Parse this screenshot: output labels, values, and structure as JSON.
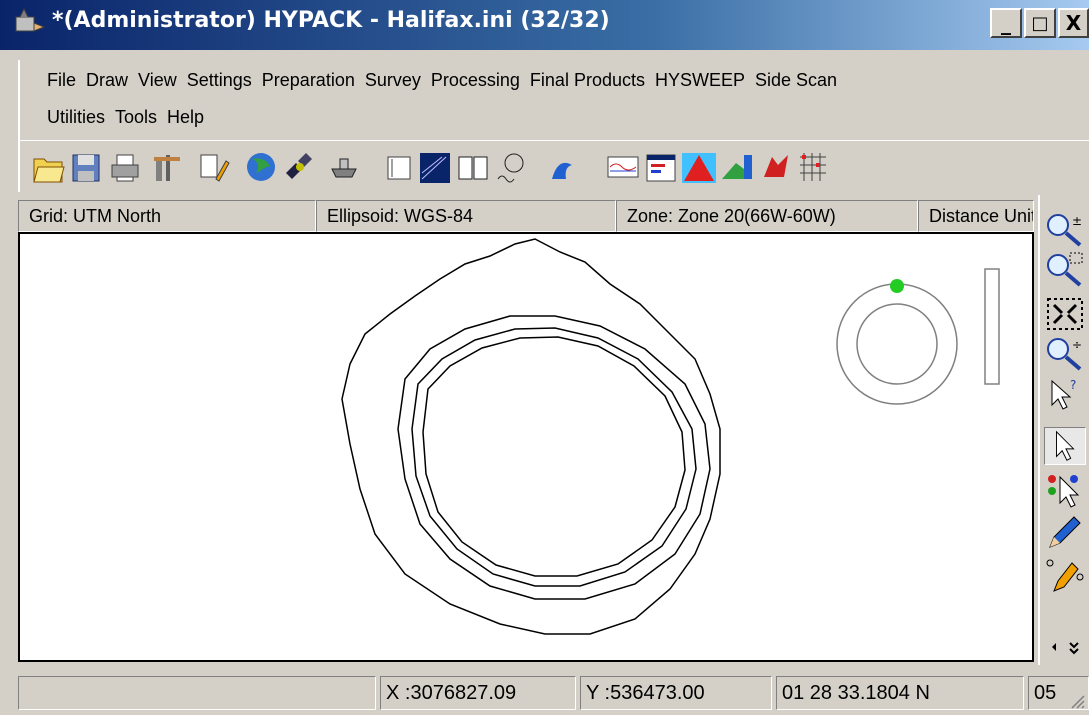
{
  "window": {
    "title": "*(Administrator) HYPACK - Halifax.ini (32/32)",
    "minimize_label": "_",
    "maximize_label": "□",
    "close_label": "X"
  },
  "menu": {
    "row1": [
      "File",
      "Draw",
      "View",
      "Settings",
      "Preparation",
      "Survey",
      "Processing",
      "Final Products",
      "HYSWEEP",
      "Side Scan"
    ],
    "row2": [
      "Utilities",
      "Tools",
      "Help"
    ]
  },
  "toolbar": {
    "icons": [
      "open-folder-icon",
      "save-disk-icon",
      "print-icon",
      "hardware-icon",
      "edit-draw-icon",
      "globe-icon",
      "satellite-icon",
      "boat-icon",
      "display-icon",
      "sounding-icon",
      "book-icon",
      "tide-icon",
      "wave-icon",
      "profile-icon",
      "chart-icon",
      "tin-icon",
      "terrain-icon",
      "dragon-icon",
      "grid-icon"
    ]
  },
  "infobar": {
    "grid": "Grid: UTM North",
    "ellipsoid": "Ellipsoid: WGS-84",
    "zone": "Zone: Zone 20(66W-60W)",
    "distance": "Distance Units:"
  },
  "status": {
    "blank": "",
    "x": "X :3076827.09",
    "y": "Y :536473.00",
    "lat": "01 28 33.1804 N",
    "extra": "05"
  },
  "right_tools": [
    "zoom-in-out-icon",
    "zoom-window-icon",
    "zoom-extents-icon",
    "zoom-point-icon",
    "query-pointer-icon",
    "select-pointer-icon",
    "multi-select-icon",
    "pen-draw-icon",
    "pen-edit-icon"
  ],
  "colors": {
    "title_start": "#0a246a",
    "face": "#d4d0c8",
    "compass_marker": "#22cc22"
  }
}
